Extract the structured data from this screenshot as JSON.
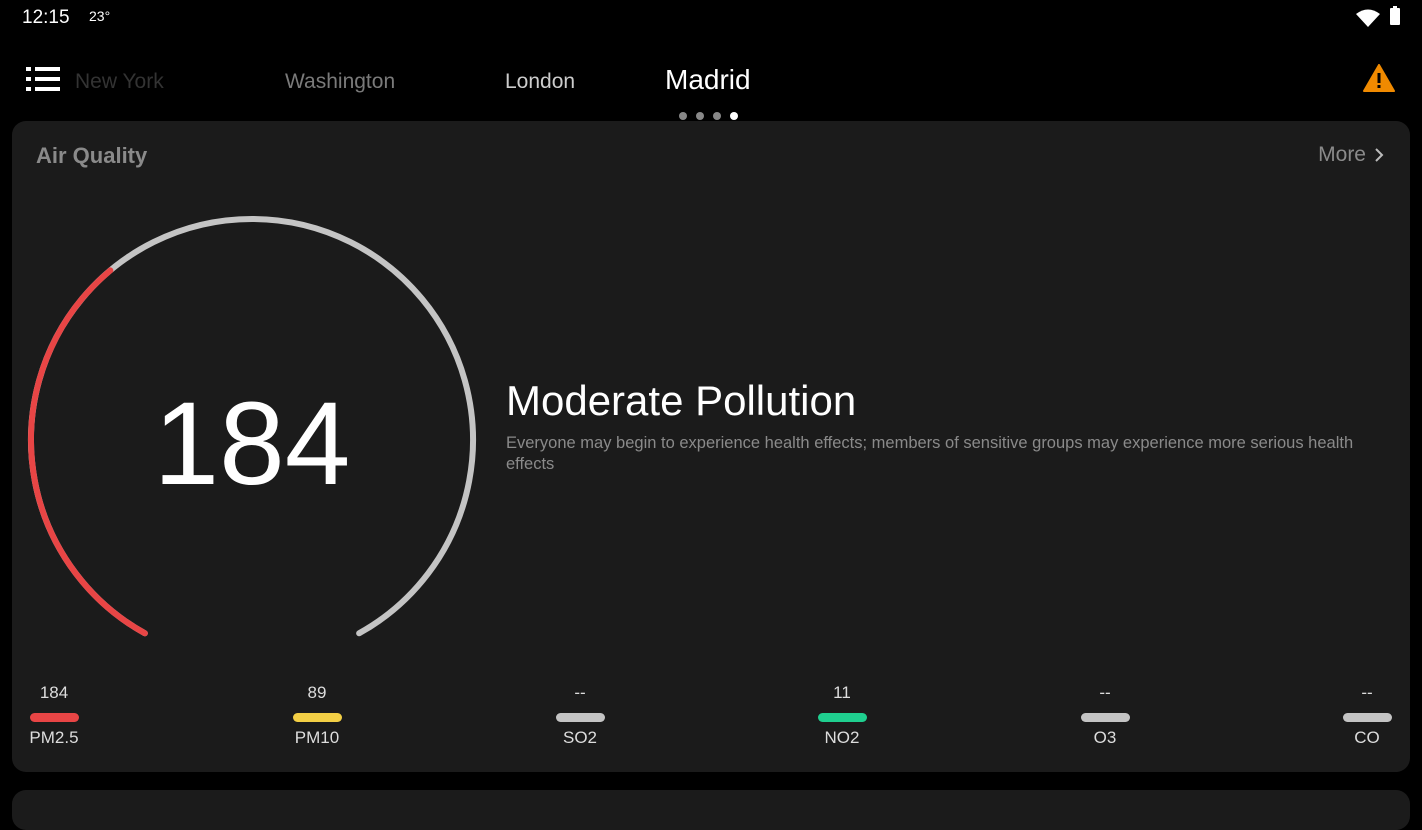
{
  "status_bar": {
    "time": "12:15",
    "temperature": "23°",
    "icons": [
      "wifi-icon",
      "battery-icon"
    ]
  },
  "header": {
    "menu_icon": "list-icon",
    "cities": [
      {
        "label": "New York",
        "active": false
      },
      {
        "label": "Washington",
        "active": false
      },
      {
        "label": "London",
        "active": false
      },
      {
        "label": "Madrid",
        "active": true
      }
    ],
    "page_indicator": {
      "count": 4,
      "active_index": 3
    },
    "alert_icon": "warning-icon",
    "alert_color": "#f08a00"
  },
  "air_quality": {
    "title": "Air Quality",
    "more_label": "More",
    "aqi_value": "184",
    "gauge": {
      "value": 184,
      "max": 500,
      "fill_color": "#e84545",
      "track_color": "#c4c4c4"
    },
    "level": "Moderate Pollution",
    "description": "Everyone may begin to experience health effects; members of sensitive groups may experience more serious health effects",
    "pollutants": [
      {
        "name": "PM2.5",
        "value": "184",
        "color": "#e84545"
      },
      {
        "name": "PM10",
        "value": "89",
        "color": "#f3cf45"
      },
      {
        "name": "SO2",
        "value": "--",
        "color": "#c4c4c4"
      },
      {
        "name": "NO2",
        "value": "11",
        "color": "#1fcf8f"
      },
      {
        "name": "O3",
        "value": "--",
        "color": "#c4c4c4"
      },
      {
        "name": "CO",
        "value": "--",
        "color": "#c4c4c4"
      }
    ]
  }
}
